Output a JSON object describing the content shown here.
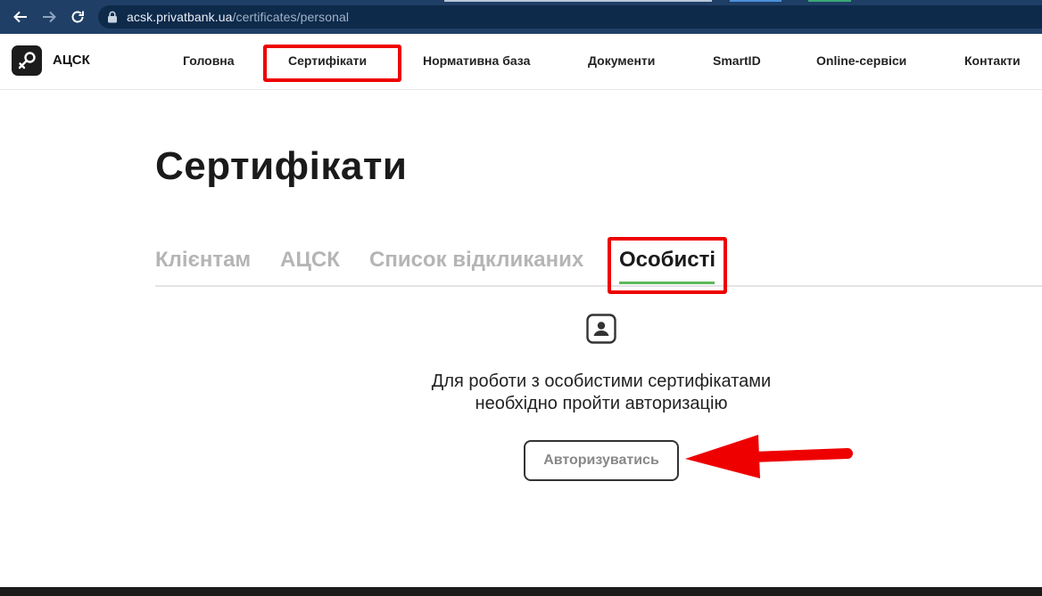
{
  "browser": {
    "url_host": "acsk.privatbank.ua",
    "url_path": "/certificates/personal"
  },
  "header": {
    "logo_text": "АЦСК",
    "nav": {
      "home": "Головна",
      "certificates": "Сертифікати",
      "regulatory": "Нормативна база",
      "documents": "Документи",
      "smartid": "SmartID",
      "online": "Online-сервіси",
      "contacts": "Контакти"
    },
    "active_nav": "certificates"
  },
  "page": {
    "title": "Сертифікати",
    "tabs": {
      "clients": "Клієнтам",
      "acsk": "АЦСК",
      "revoked": "Список відкликаних",
      "personal": "Особисті"
    },
    "active_tab": "personal",
    "message_line1": "Для роботи з особистими сертифікатами",
    "message_line2": "необхідно пройти авторизацію",
    "auth_button": "Авторизуватись"
  },
  "annotations": {
    "highlight_color": "#ee0000",
    "arrow_color": "#ee0000",
    "tab_underline_color": "#5cb85c"
  },
  "icons": {
    "back": "arrow-left-icon",
    "forward": "arrow-right-icon",
    "reload": "reload-icon",
    "lock": "lock-icon",
    "logo": "key-icon",
    "user": "user-icon"
  }
}
